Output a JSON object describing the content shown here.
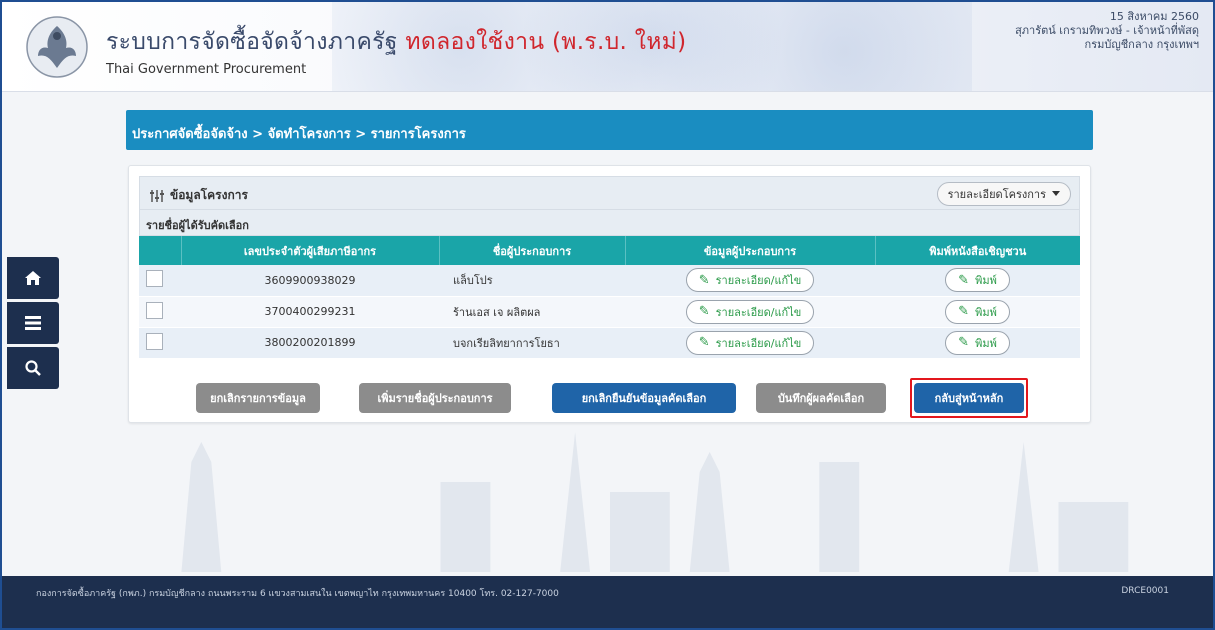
{
  "header": {
    "system_title": "ระบบการจัดซื้อจัดจ้างภาครัฐ",
    "trial_label": "ทดลองใช้งาน (พ.ร.บ. ใหม่)",
    "subtitle": "Thai Government Procurement",
    "date": "15 สิงหาคม 2560",
    "user": "สุภารัตน์ เกรามทิพวงษ์ - เจ้าหน้าที่พัสดุ",
    "department": "กรมบัญชีกลาง กรุงเทพฯ"
  },
  "side_icons": [
    "home-icon",
    "menu-icon",
    "search-icon"
  ],
  "breadcrumb": "ประกาศจัดซื้อจัดจ้าง > จัดทำโครงการ > รายการโครงการ",
  "panel": {
    "title": "ข้อมูลโครงการ",
    "detail_button": "รายละเอียดโครงการ",
    "section_title": "รายชื่อผู้ได้รับคัดเลือก",
    "columns": [
      "เลขประจำตัวผู้เสียภาษีอากร",
      "ชื่อผู้ประกอบการ",
      "ข้อมูลผู้ประกอบการ",
      "พิมพ์หนังสือเชิญชวน"
    ],
    "rows": [
      {
        "tax_id": "3609900938029",
        "name": "แล็บโปร",
        "info": "รายละเอียด/แก้ไข",
        "print": "พิมพ์"
      },
      {
        "tax_id": "3700400299231",
        "name": "ร้านเอส เจ ผลิตผล",
        "info": "รายละเอียด/แก้ไข",
        "print": "พิมพ์"
      },
      {
        "tax_id": "3800200201899",
        "name": "บจกเรียลิทยาการโยธา",
        "info": "รายละเอียด/แก้ไข",
        "print": "พิมพ์"
      }
    ]
  },
  "buttons": {
    "delete": "ยกเลิกรายการข้อมูล",
    "add": "เพิ่มรายชื่อผู้ประกอบการ",
    "confirm": "ยกเลิกยืนยันข้อมูลคัดเลือก",
    "save": "บันทึกผู้ผลคัดเลือก",
    "back": "กลับสู่หน้าหลัก"
  },
  "footer": {
    "address": "กองการจัดซื้อภาครัฐ (กพภ.) กรมบัญชีกลาง ถนนพระราม 6 แขวงสามเสนใน เขตพญาไท กรุงเทพมหานคร 10400 โทร. 02-127-7000",
    "code": "DRCE0001"
  },
  "colors": {
    "breadcrumb": "#1a8dc1",
    "table_header": "#1aa5a8",
    "footer": "#1d2f4e",
    "highlight": "#e3171d"
  }
}
